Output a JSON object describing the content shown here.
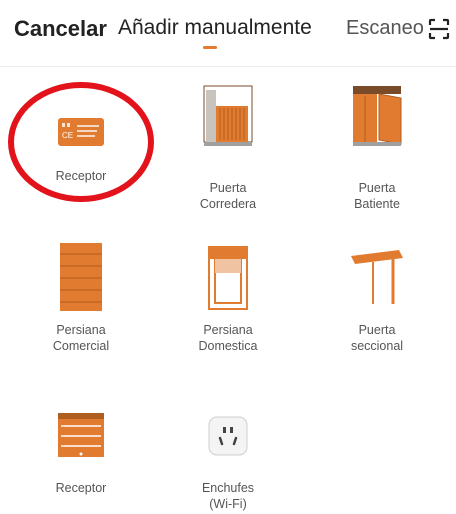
{
  "header": {
    "cancel_label": "Cancelar",
    "tabs": [
      {
        "label": "Añadir manualmente",
        "active": true
      },
      {
        "label": "Escaneo"
      }
    ],
    "scan_icon": "scan-icon"
  },
  "accent_color": "#e07b2f",
  "highlight_color": "#e3131b",
  "devices": [
    {
      "label": "Receptor",
      "icon": "receiver-card-icon"
    },
    {
      "label": "Puerta\nCorredera",
      "icon": "sliding-gate-icon"
    },
    {
      "label": "Puerta\nBatiente",
      "icon": "swing-door-icon"
    },
    {
      "label": "Persiana\nComercial",
      "icon": "commercial-shutter-icon"
    },
    {
      "label": "Persiana\nDomestica",
      "icon": "domestic-shutter-icon"
    },
    {
      "label": "Puerta\nseccional",
      "icon": "sectional-door-icon"
    },
    {
      "label": "Receptor",
      "icon": "garage-receiver-icon"
    },
    {
      "label": "Enchufes\n(Wi-Fi)",
      "icon": "wifi-plug-icon"
    }
  ]
}
